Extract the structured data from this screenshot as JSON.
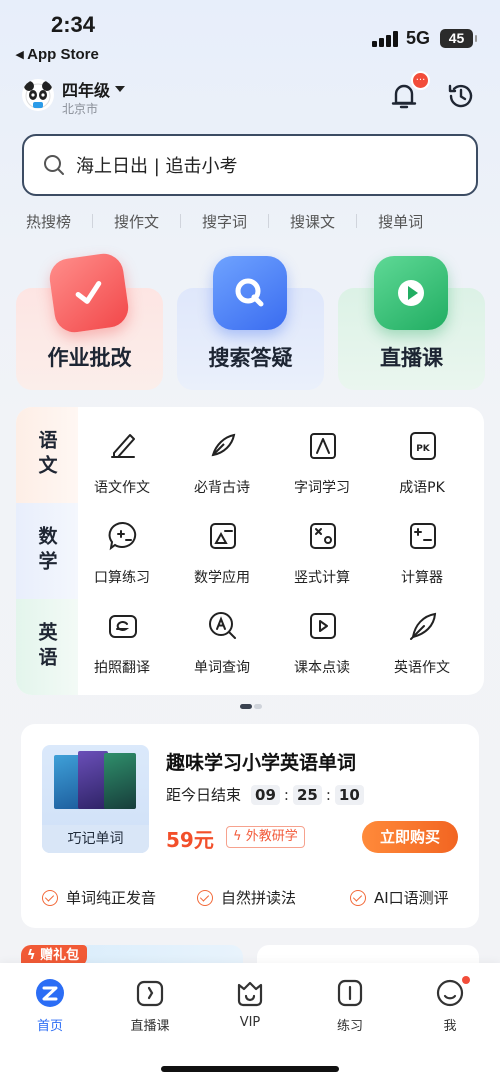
{
  "status": {
    "time": "2:34",
    "back": "◂ App Store",
    "network": "5G",
    "battery": "45"
  },
  "header": {
    "grade": "四年级",
    "city": "北京市",
    "bell_badge": "···"
  },
  "search": {
    "text": "海上日出 | 追击小考"
  },
  "hot_links": [
    "热搜榜",
    "搜作文",
    "搜字词",
    "搜课文",
    "搜单词"
  ],
  "big_cards": [
    "作业批改",
    "搜索答疑",
    "直播课"
  ],
  "subjects": {
    "chinese": {
      "label": "语文",
      "items": [
        "语文作文",
        "必背古诗",
        "字词学习",
        "成语PK"
      ]
    },
    "math": {
      "label": "数学",
      "items": [
        "口算练习",
        "数学应用",
        "竖式计算",
        "计算器"
      ]
    },
    "english": {
      "label": "英语",
      "items": [
        "拍照翻译",
        "单词查询",
        "课本点读",
        "英语作文"
      ]
    }
  },
  "promo": {
    "book_label": "巧记单词",
    "title": "趣味学习小学英语单词",
    "ends_label": "距今日结束",
    "countdown": [
      "09",
      "25",
      "10"
    ],
    "price": "59元",
    "tag": "外教研学",
    "buy": "立即购买",
    "features": [
      "单词纯正发音",
      "自然拼读法",
      "AI口语测评"
    ]
  },
  "gift_badge": "赠礼包",
  "tabs": [
    "首页",
    "直播课",
    "VIP",
    "练习",
    "我"
  ],
  "colors": {
    "accent": "#2b6df5",
    "orange": "#f26522",
    "red": "#f24d3a"
  }
}
